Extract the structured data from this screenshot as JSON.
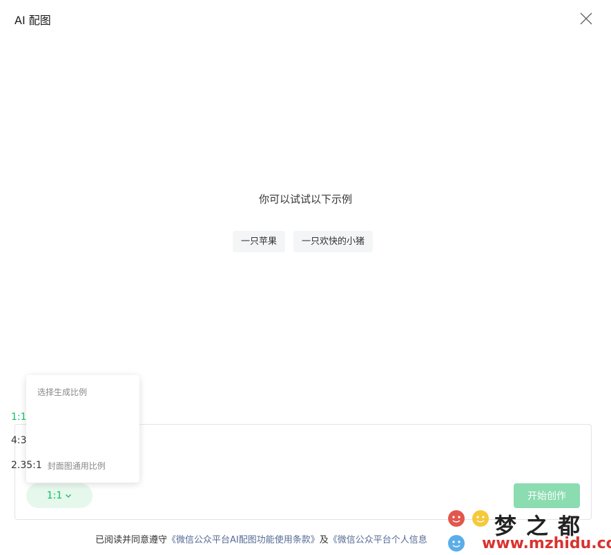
{
  "dialog": {
    "title": "AI 配图",
    "close_icon": "close-icon"
  },
  "main": {
    "hint": "你可以试试以下示例",
    "examples": [
      {
        "label": "一只苹果"
      },
      {
        "label": "一只欢快的小猪"
      }
    ]
  },
  "ratio_dropdown": {
    "title": "选择生成比例",
    "options": [
      {
        "label": "1:1",
        "note": "",
        "selected": true
      },
      {
        "label": "4:3",
        "note": ""
      },
      {
        "label": "2.35:1",
        "note": "封面图通用比例"
      }
    ]
  },
  "toolbar": {
    "ratio_value": "1:1",
    "ratio_icon": "chevron-down-icon",
    "start_label": "开始创作"
  },
  "agreement": {
    "prefix": "已阅读并同意遵守",
    "link1": "《微信公众平台AI配图功能使用条款》",
    "middle": "及",
    "link2": "《微信公众平台个人信息"
  },
  "watermark": {
    "title": "梦之都",
    "url": "www.mzhidu.com"
  },
  "colors": {
    "accent": "#07c160",
    "accent_light": "#e6f7ec",
    "disabled_button": "#8bdcb1",
    "link": "#576b95"
  }
}
